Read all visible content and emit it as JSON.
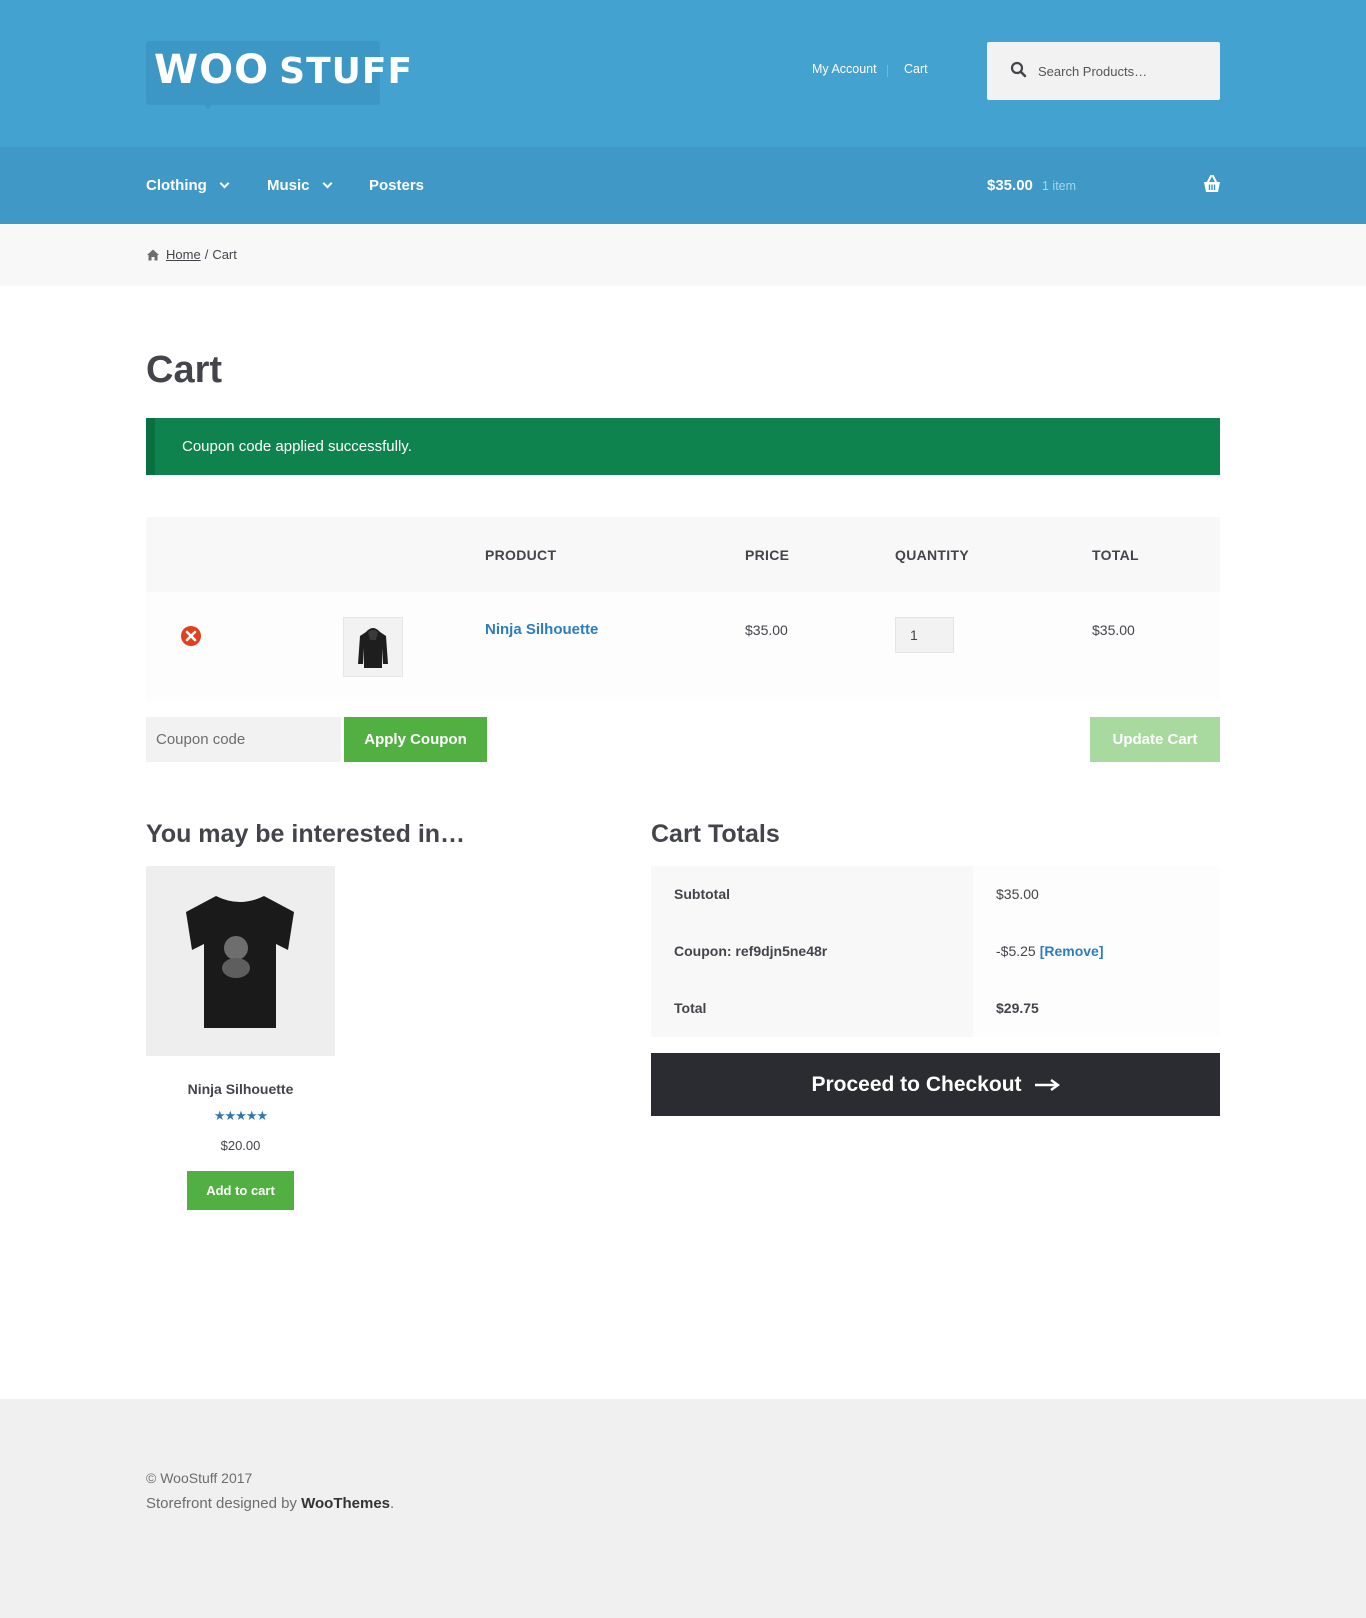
{
  "brand": {
    "logo_woo": "WOO",
    "logo_stuff": "STUFF"
  },
  "header": {
    "links": [
      "My Account",
      "Cart"
    ],
    "search_placeholder": "Search Products…"
  },
  "nav": {
    "items": [
      {
        "label": "Clothing",
        "has_dropdown": true
      },
      {
        "label": "Music",
        "has_dropdown": true
      },
      {
        "label": "Posters",
        "has_dropdown": false
      }
    ],
    "cart_amount": "$35.00",
    "cart_count": "1 item"
  },
  "breadcrumb": {
    "home": "Home",
    "sep": "/",
    "current": "Cart"
  },
  "page": {
    "title": "Cart",
    "notice": "Coupon code applied successfully."
  },
  "cart": {
    "columns": [
      "PRODUCT",
      "PRICE",
      "QUANTITY",
      "TOTAL"
    ],
    "rows": [
      {
        "product": "Ninja Silhouette",
        "price": "$35.00",
        "quantity": "1",
        "total": "$35.00"
      }
    ],
    "coupon_placeholder": "Coupon code",
    "apply_coupon": "Apply Coupon",
    "update_cart": "Update Cart"
  },
  "cross_sells": {
    "title": "You may be interested in…",
    "product": {
      "name": "Ninja Silhouette",
      "rating": 5,
      "price": "$20.00",
      "button": "Add to cart"
    }
  },
  "totals": {
    "title": "Cart Totals",
    "subtotal_label": "Subtotal",
    "subtotal": "$35.00",
    "coupon_label": "Coupon: ref9djn5ne48r",
    "coupon_value": "-$5.25",
    "coupon_remove": "[Remove]",
    "total_label": "Total",
    "total": "$29.75",
    "checkout": "Proceed to Checkout"
  },
  "footer": {
    "copyright": "© WooStuff 2017",
    "credit_prefix": "Storefront designed by",
    "credit_link": "WooThemes",
    "credit_suffix": "."
  },
  "colors": {
    "header": "#43a2d0",
    "nav": "#3f98c6",
    "notice": "#0f834d",
    "button_green": "#52b043",
    "button_disabled": "#a8daa0",
    "link_blue": "#2c7dbe",
    "checkout": "#2b2c31"
  }
}
